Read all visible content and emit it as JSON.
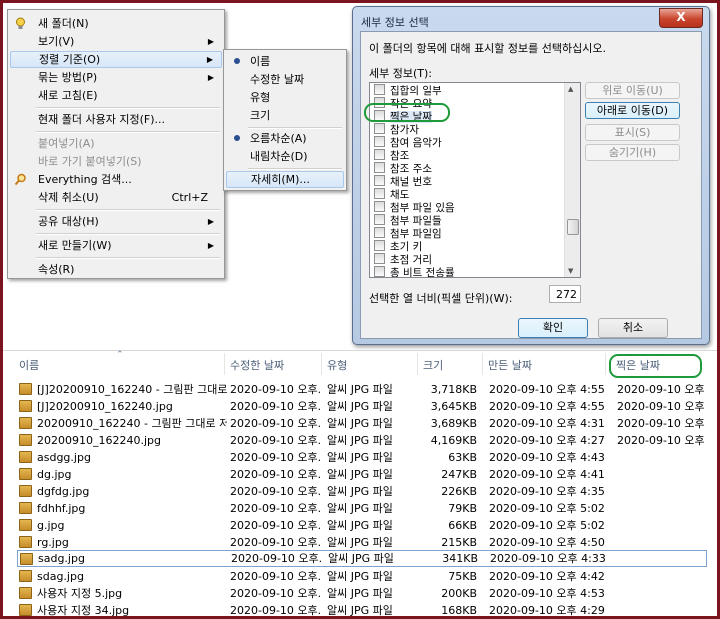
{
  "context_menu": {
    "new_folder": "새 폴더(N)",
    "view": "보기(V)",
    "sort_by": "정렬 기준(O)",
    "group_by": "묶는 방법(P)",
    "refresh": "새로 고침(E)",
    "customize": "현재 폴더 사용자 지정(F)...",
    "paste": "붙여넣기(A)",
    "paste_shortcut": "바로 가기 붙여넣기(S)",
    "everything": "Everything 검색...",
    "undo_delete": "삭제 취소(U)",
    "undo_shortcut": "Ctrl+Z",
    "share": "공유 대상(H)",
    "new": "새로 만들기(W)",
    "properties": "속성(R)"
  },
  "sort_submenu": {
    "name": "이름",
    "date_modified": "수정한 날짜",
    "type": "유형",
    "size": "크기",
    "ascending": "오름차순(A)",
    "descending": "내림차순(D)",
    "more": "자세히(M)..."
  },
  "dialog": {
    "title": "세부 정보 선택",
    "close": "X",
    "description": "이 폴더의 항목에 대해 표시할 정보를 선택하십시오.",
    "details_label": "세부 정보(T):",
    "items": [
      "집합의 일부",
      "작은 요약",
      "찍은 날짜",
      "참가자",
      "참여 음악가",
      "참조",
      "참조 주소",
      "채널 번호",
      "채도",
      "첨부 파일 있음",
      "첨부 파일들",
      "첨부 파일임",
      "초기 키",
      "초점 거리",
      "총 비트 전송률"
    ],
    "buttons": {
      "move_up": "위로 이동(U)",
      "move_down": "아래로 이동(D)",
      "show": "표시(S)",
      "hide": "숨기기(H)"
    },
    "width_label": "선택한 열 너비(픽셀 단위)(W):",
    "width_value": "272",
    "ok": "확인",
    "cancel": "취소"
  },
  "explorer": {
    "columns": {
      "name": "이름",
      "modified": "수정한 날짜",
      "type": "유형",
      "size": "크기",
      "created": "만든 날짜",
      "taken": "찍은 날짜"
    },
    "rows": [
      {
        "name": "[J]20200910_162240 - 그림판 그대로 ...",
        "modified": "2020-09-10 오후...",
        "type": "알씨 JPG 파일",
        "size": "3,718KB",
        "created": "2020-09-10 오후 4:55",
        "taken": "2020-09-10 오후"
      },
      {
        "name": "[J]20200910_162240.jpg",
        "modified": "2020-09-10 오후...",
        "type": "알씨 JPG 파일",
        "size": "3,645KB",
        "created": "2020-09-10 오후 4:55",
        "taken": "2020-09-10 오후"
      },
      {
        "name": "20200910_162240 - 그림판 그대로 저...",
        "modified": "2020-09-10 오후...",
        "type": "알씨 JPG 파일",
        "size": "3,689KB",
        "created": "2020-09-10 오후 4:31",
        "taken": "2020-09-10 오후"
      },
      {
        "name": "20200910_162240.jpg",
        "modified": "2020-09-10 오후...",
        "type": "알씨 JPG 파일",
        "size": "4,169KB",
        "created": "2020-09-10 오후 4:27",
        "taken": "2020-09-10 오후"
      },
      {
        "name": "asdgg.jpg",
        "modified": "2020-09-10 오후...",
        "type": "알씨 JPG 파일",
        "size": "63KB",
        "created": "2020-09-10 오후 4:43",
        "taken": ""
      },
      {
        "name": "dg.jpg",
        "modified": "2020-09-10 오후...",
        "type": "알씨 JPG 파일",
        "size": "247KB",
        "created": "2020-09-10 오후 4:41",
        "taken": ""
      },
      {
        "name": "dgfdg.jpg",
        "modified": "2020-09-10 오후...",
        "type": "알씨 JPG 파일",
        "size": "226KB",
        "created": "2020-09-10 오후 4:35",
        "taken": ""
      },
      {
        "name": "fdhhf.jpg",
        "modified": "2020-09-10 오후...",
        "type": "알씨 JPG 파일",
        "size": "79KB",
        "created": "2020-09-10 오후 5:02",
        "taken": ""
      },
      {
        "name": "g.jpg",
        "modified": "2020-09-10 오후...",
        "type": "알씨 JPG 파일",
        "size": "66KB",
        "created": "2020-09-10 오후 5:02",
        "taken": ""
      },
      {
        "name": "rg.jpg",
        "modified": "2020-09-10 오후...",
        "type": "알씨 JPG 파일",
        "size": "215KB",
        "created": "2020-09-10 오후 4:50",
        "taken": ""
      },
      {
        "name": "sadg.jpg",
        "modified": "2020-09-10 오후...",
        "type": "알씨 JPG 파일",
        "size": "341KB",
        "created": "2020-09-10 오후 4:33",
        "taken": ""
      },
      {
        "name": "sdag.jpg",
        "modified": "2020-09-10 오후...",
        "type": "알씨 JPG 파일",
        "size": "75KB",
        "created": "2020-09-10 오후 4:42",
        "taken": ""
      },
      {
        "name": "사용자 지정 5.jpg",
        "modified": "2020-09-10 오후...",
        "type": "알씨 JPG 파일",
        "size": "200KB",
        "created": "2020-09-10 오후 4:53",
        "taken": ""
      },
      {
        "name": "사용자 지정 34.jpg",
        "modified": "2020-09-10 오후...",
        "type": "알씨 JPG 파일",
        "size": "168KB",
        "created": "2020-09-10 오후 4:29",
        "taken": ""
      }
    ]
  },
  "colors": {
    "outer_border": "#7a1520",
    "highlight_ring": "#1f9a3a",
    "menu_bg": "#f0f0f0",
    "header_text": "#4c607a"
  }
}
